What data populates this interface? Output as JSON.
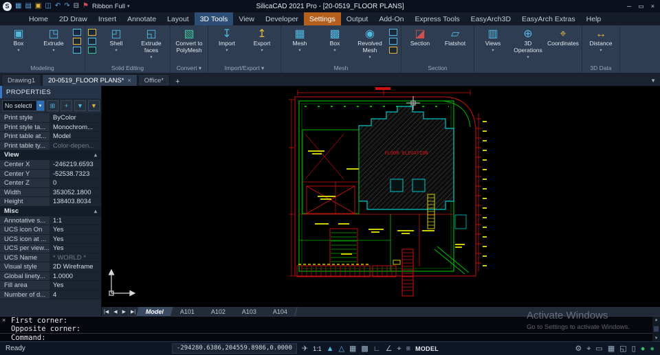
{
  "window": {
    "title": "SilicaCAD 2021 Pro - [20-0519_FLOOR PLANS]",
    "logo": "S",
    "ribbon_mode": "Ribbon Full",
    "minimize": "─",
    "restore": "▭",
    "close": "×"
  },
  "quick_access": [
    {
      "name": "menu-grid-icon",
      "glyph": "▦",
      "color": "#5aa7e0"
    },
    {
      "name": "new-file-icon",
      "glyph": "▤",
      "color": "#5aa7e0"
    },
    {
      "name": "open-folder-icon",
      "glyph": "▣",
      "color": "#e3b73d"
    },
    {
      "name": "save-icon",
      "glyph": "◫",
      "color": "#5aa7e0"
    },
    {
      "name": "undo-icon",
      "glyph": "↶",
      "color": "#5aa7e0"
    },
    {
      "name": "redo-icon",
      "glyph": "↷",
      "color": "#5aa7e0"
    },
    {
      "name": "print-icon",
      "glyph": "⊟",
      "color": "#b9c3cf"
    },
    {
      "name": "flag-icon",
      "glyph": "⚑",
      "color": "#d05050"
    }
  ],
  "menu": {
    "tabs": [
      "Home",
      "2D Draw",
      "Insert",
      "Annotate",
      "Layout",
      "3D Tools",
      "View",
      "Developer",
      "Settings",
      "Output",
      "Add-On",
      "Express Tools",
      "EasyArch3D",
      "EasyArch Extras",
      "Help"
    ],
    "active": "3D Tools",
    "highlight": "Settings"
  },
  "ribbon": {
    "groups": [
      {
        "label": "Modeling",
        "arrow": false,
        "buttons": [
          {
            "name": "box-button",
            "label": "Box",
            "glyph": "▣",
            "color": "#52b8e0",
            "dd": true
          },
          {
            "name": "extrude-button",
            "label": "Extrude",
            "glyph": "◳",
            "color": "#52b8e0",
            "dd": true
          },
          {
            "name": "modeling-tools-stack",
            "stack": [
              "#52b8e0",
              "#e3b73d",
              "#52b8e0"
            ]
          }
        ]
      },
      {
        "label": "Solid Editing",
        "arrow": false,
        "buttons": [
          {
            "name": "solid-editing-stack",
            "stack": [
              "#e3b73d",
              "#52b8e0",
              "#3ec6a0"
            ]
          },
          {
            "name": "shell-button",
            "label": "Shell",
            "glyph": "◰",
            "color": "#52b8e0",
            "dd": true
          },
          {
            "name": "extrude-faces-button",
            "label": "Extrude faces",
            "glyph": "◱",
            "color": "#52b8e0",
            "dd": true
          }
        ]
      },
      {
        "label": "Convert",
        "arrow": true,
        "buttons": [
          {
            "name": "convert-to-polymesh-button",
            "label": "Convert to PolyMesh",
            "glyph": "▧",
            "color": "#3ec6a0"
          }
        ]
      },
      {
        "label": "Import/Export",
        "arrow": true,
        "buttons": [
          {
            "name": "import-button",
            "label": "Import",
            "glyph": "↧",
            "color": "#52b8e0",
            "dd": true
          },
          {
            "name": "export-button",
            "label": "Export",
            "glyph": "↥",
            "color": "#e3b73d",
            "dd": true
          }
        ]
      },
      {
        "label": "Mesh",
        "arrow": false,
        "buttons": [
          {
            "name": "mesh-button",
            "label": "Mesh",
            "glyph": "▦",
            "color": "#52b8e0",
            "dd": true
          },
          {
            "name": "mesh-box-button",
            "label": "Box",
            "glyph": "▩",
            "color": "#52b8e0",
            "dd": true
          },
          {
            "name": "revolved-mesh-button",
            "label": "Revolved Mesh",
            "glyph": "◉",
            "color": "#52b8e0",
            "dd": true
          },
          {
            "name": "mesh-tools-stack",
            "stack": [
              "#52b8e0",
              "#52b8e0",
              "#e3b73d"
            ]
          }
        ]
      },
      {
        "label": "Section",
        "arrow": false,
        "buttons": [
          {
            "name": "section-button",
            "label": "Section",
            "glyph": "◪",
            "color": "#d05050"
          },
          {
            "name": "flatshot-button",
            "label": "Flatshot",
            "glyph": "▱",
            "color": "#52b8e0"
          }
        ]
      },
      {
        "label": "",
        "arrow": false,
        "buttons": [
          {
            "name": "views-button",
            "label": "Views",
            "glyph": "▥",
            "color": "#52b8e0",
            "dd": true
          },
          {
            "name": "3d-operations-button",
            "label": "3D Operations",
            "glyph": "⊕",
            "color": "#52b8e0",
            "dd": true
          },
          {
            "name": "coordinates-button",
            "label": "Coordinates",
            "glyph": "⌖",
            "color": "#e3b73d"
          }
        ]
      },
      {
        "label": "3D Data",
        "arrow": false,
        "buttons": [
          {
            "name": "distance-button",
            "label": "Distance",
            "glyph": "↔",
            "color": "#e3b73d",
            "dd": true
          }
        ]
      }
    ]
  },
  "doc_tabs": {
    "tabs": [
      {
        "label": "Drawing1",
        "active": false,
        "closable": false
      },
      {
        "label": "20-0519_FLOOR PLANS*",
        "active": true,
        "closable": true
      },
      {
        "label": "Office*",
        "active": false,
        "closable": false
      }
    ],
    "add_label": "+",
    "scroll_glyph": "▼"
  },
  "properties": {
    "title": "PROPERTIES",
    "selector": "No selecti",
    "selector_arrow": "▾",
    "toolbar_icons": [
      {
        "name": "select-objects-icon",
        "glyph": "⊞",
        "color": "#57b6e0"
      },
      {
        "name": "add-selection-icon",
        "glyph": "+",
        "color": "#57b6e0"
      },
      {
        "name": "quick-select-icon",
        "glyph": "▼",
        "color": "#57b6e0"
      },
      {
        "name": "filter-icon",
        "glyph": "▼",
        "color": "#e3b73d"
      }
    ],
    "rows": [
      {
        "label": "Print style",
        "value": "ByColor"
      },
      {
        "label": "Print style ta...",
        "value": "Monochrom..."
      },
      {
        "label": "Print table at...",
        "value": "Model"
      },
      {
        "label": "Print table ty...",
        "value": "Color-depen...",
        "dim": true
      },
      {
        "header": "View",
        "caret": "▴"
      },
      {
        "label": "Center X",
        "value": "-246219.6593"
      },
      {
        "label": "Center Y",
        "value": "-52538.7323"
      },
      {
        "label": "Center Z",
        "value": "0"
      },
      {
        "label": "Width",
        "value": "353052.1800"
      },
      {
        "label": "Height",
        "value": "138403.8034"
      },
      {
        "header": "Misc",
        "caret": "▴"
      },
      {
        "label": "Annotative s...",
        "value": "1:1"
      },
      {
        "label": "UCS icon On",
        "value": "Yes"
      },
      {
        "label": "UCS icon at ...",
        "value": "Yes"
      },
      {
        "label": "UCS per view...",
        "value": "Yes"
      },
      {
        "label": "UCS Name",
        "value": "* WORLD *",
        "dim": true
      },
      {
        "label": "Visual style",
        "value": "2D Wireframe"
      },
      {
        "label": "Global linety...",
        "value": "1.0000"
      },
      {
        "label": "Fill area",
        "value": "Yes"
      },
      {
        "label": "Number of d...",
        "value": "4"
      }
    ]
  },
  "drawing": {
    "annotation": "FLOOR ELEVATION",
    "colors": {
      "boundary_green": "#00b300",
      "dimension_red": "#d01010",
      "label_yellow": "#cfcf00",
      "outline_cyan": "#00c8c8"
    }
  },
  "model_tabs": {
    "nav": [
      "|◀",
      "◀",
      "▶",
      "▶|"
    ],
    "tabs": [
      "Model",
      "A101",
      "A102",
      "A103",
      "A104"
    ],
    "active": "Model"
  },
  "command": {
    "close": "×",
    "lines": [
      "First corner:",
      "Opposite corner:",
      "Command:"
    ],
    "scroll_up": "▲",
    "scroll_down": "▼"
  },
  "watermark": {
    "line1": "Activate Windows",
    "line2": "Go to Settings to activate Windows."
  },
  "status": {
    "ready": "Ready",
    "coords": "-294280.6386,204559.8986,0.0000",
    "mid_icons": [
      {
        "name": "plane-icon",
        "glyph": "✈"
      },
      {
        "name": "annotation-scale-label",
        "text": "1:1"
      },
      {
        "name": "annotation-icon",
        "glyph": "▲",
        "color": "#52b8e0"
      },
      {
        "name": "auto-annotation-icon",
        "glyph": "△",
        "color": "#52b8e0"
      },
      {
        "name": "grid-icon",
        "glyph": "▦"
      },
      {
        "name": "snap-icon",
        "glyph": "▩"
      },
      {
        "name": "ortho-icon",
        "glyph": "∟"
      },
      {
        "name": "polar-icon",
        "glyph": "∠"
      },
      {
        "name": "osnap-icon",
        "glyph": "⌖"
      },
      {
        "name": "lineweight-icon",
        "glyph": "≡"
      }
    ],
    "model_label": "MODEL",
    "right_icons": [
      {
        "name": "gear-icon",
        "glyph": "⚙"
      },
      {
        "name": "crosshair-icon",
        "glyph": "⌖"
      },
      {
        "name": "display-icon",
        "glyph": "▭"
      },
      {
        "name": "hardware-grid-icon",
        "glyph": "▦"
      },
      {
        "name": "clean-screen-icon",
        "glyph": "◱"
      },
      {
        "name": "battery-icon",
        "glyph": "▯"
      },
      {
        "name": "status-ok-icon",
        "glyph": "●",
        "color": "#35c06a"
      },
      {
        "name": "status-info-icon",
        "glyph": "●",
        "color": "#2e9e5b"
      }
    ]
  }
}
